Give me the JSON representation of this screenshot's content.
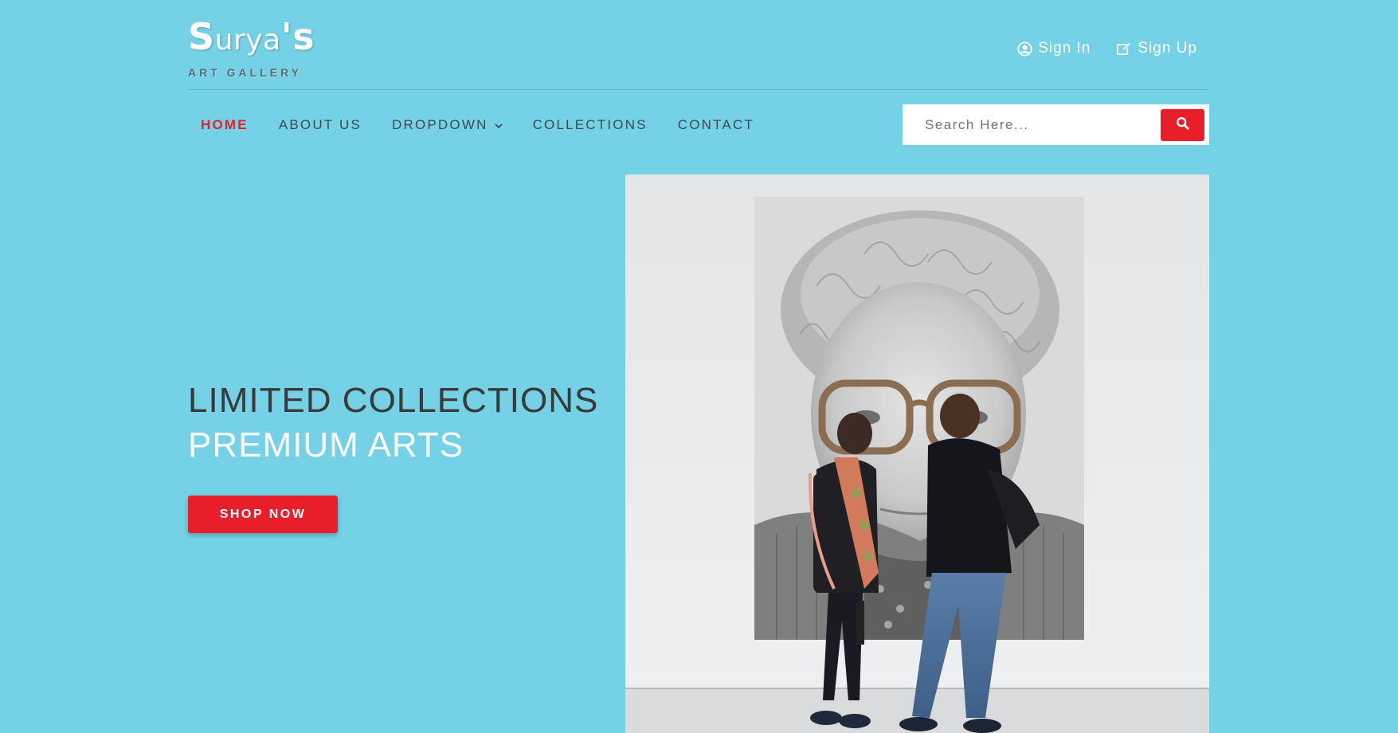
{
  "brand": {
    "name_first": "S",
    "name_middle": "urya",
    "name_last": "'s",
    "tagline": "ART GALLERY"
  },
  "auth": {
    "sign_in": "Sign In",
    "sign_up": "Sign Up",
    "sign_in_icon": "user-circle-icon",
    "sign_up_icon": "edit-icon"
  },
  "nav": {
    "items": [
      {
        "label": "HOME",
        "active": true
      },
      {
        "label": "ABOUT US"
      },
      {
        "label": "DROPDOWN",
        "has_dropdown": true
      },
      {
        "label": "COLLECTIONS"
      },
      {
        "label": "CONTACT"
      }
    ]
  },
  "search": {
    "placeholder": "Search Here...",
    "icon": "search-icon"
  },
  "hero": {
    "line1": "LIMITED COLLECTIONS",
    "line2": "PREMIUM ARTS",
    "cta": "SHOP NOW"
  },
  "colors": {
    "background": "#74d1e6",
    "accent": "#e81f2b",
    "text_dark": "#3a3a3a",
    "white": "#ffffff"
  }
}
